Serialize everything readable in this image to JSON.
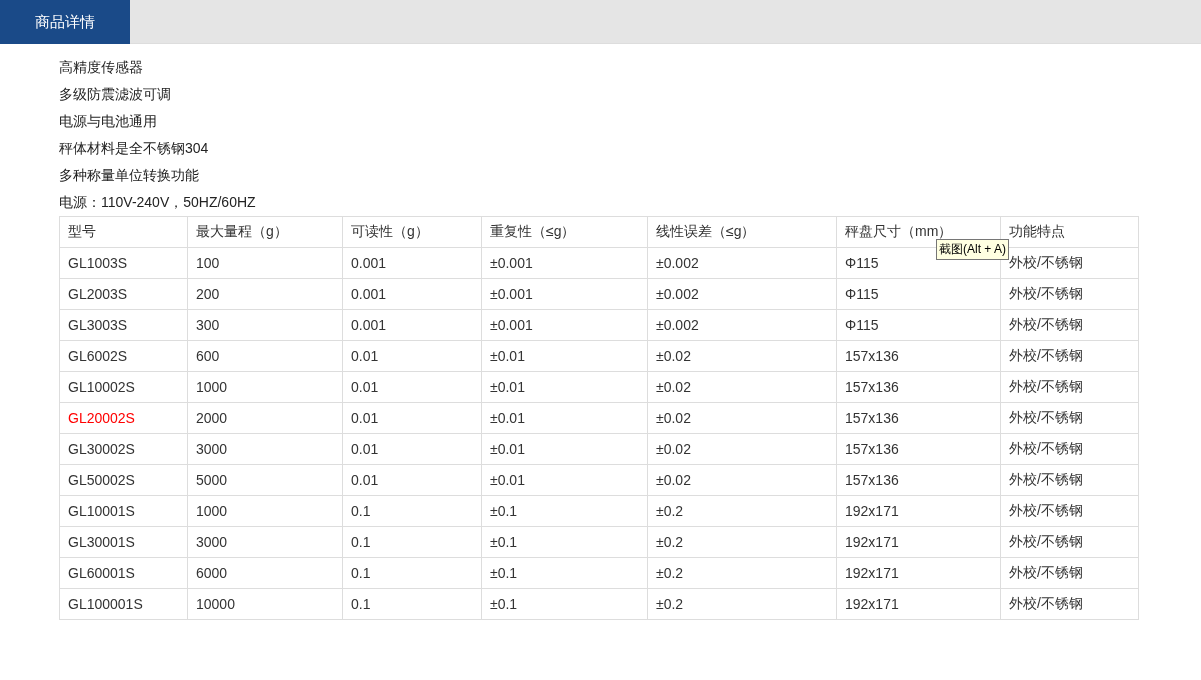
{
  "tab": {
    "label": "商品详情",
    "selected": true
  },
  "features": [
    "高精度传感器",
    "多级防震滤波可调",
    "电源与电池通用",
    "秤体材料是全不锈钢304",
    "多种称量单位转换功能",
    "电源：110V-240V，50HZ/60HZ"
  ],
  "table": {
    "columns": [
      "型号",
      "最大量程（g）",
      "可读性（g）",
      "重复性（≤g）",
      "线性误差（≤g）",
      "秤盘尺寸（mm）",
      "功能特点"
    ],
    "rows": [
      {
        "highlighted": false,
        "cells": [
          "GL1003S",
          "100",
          "0.001",
          "±0.001",
          "±0.002",
          "Φ115",
          "外校/不锈钢"
        ]
      },
      {
        "highlighted": false,
        "cells": [
          "GL2003S",
          "200",
          "0.001",
          "±0.001",
          "±0.002",
          "Φ115",
          "外校/不锈钢"
        ]
      },
      {
        "highlighted": false,
        "cells": [
          "GL3003S",
          "300",
          "0.001",
          "±0.001",
          "±0.002",
          "Φ115",
          "外校/不锈钢"
        ]
      },
      {
        "highlighted": false,
        "cells": [
          "GL6002S",
          "600",
          "0.01",
          "±0.01",
          "±0.02",
          "157x136",
          "外校/不锈钢"
        ]
      },
      {
        "highlighted": false,
        "cells": [
          "GL10002S",
          "1000",
          "0.01",
          "±0.01",
          "±0.02",
          "157x136",
          "外校/不锈钢"
        ]
      },
      {
        "highlighted": true,
        "cells": [
          "GL20002S",
          "2000",
          "0.01",
          "±0.01",
          "±0.02",
          "157x136",
          "外校/不锈钢"
        ]
      },
      {
        "highlighted": false,
        "cells": [
          "GL30002S",
          "3000",
          "0.01",
          "±0.01",
          "±0.02",
          "157x136",
          "外校/不锈钢"
        ]
      },
      {
        "highlighted": false,
        "cells": [
          "GL50002S",
          "5000",
          "0.01",
          "±0.01",
          "±0.02",
          "157x136",
          "外校/不锈钢"
        ]
      },
      {
        "highlighted": false,
        "cells": [
          "GL10001S",
          "1000",
          "0.1",
          "±0.1",
          "±0.2",
          "192x171",
          "外校/不锈钢"
        ]
      },
      {
        "highlighted": false,
        "cells": [
          "GL30001S",
          "3000",
          "0.1",
          "±0.1",
          "±0.2",
          "192x171",
          "外校/不锈钢"
        ]
      },
      {
        "highlighted": false,
        "cells": [
          "GL60001S",
          "6000",
          "0.1",
          "±0.1",
          "±0.2",
          "192x171",
          "外校/不锈钢"
        ]
      },
      {
        "highlighted": false,
        "cells": [
          "GL100001S",
          "10000",
          "0.1",
          "±0.1",
          "±0.2",
          "192x171",
          "外校/不锈钢"
        ]
      }
    ]
  },
  "tooltip": "截图(Alt + A)"
}
